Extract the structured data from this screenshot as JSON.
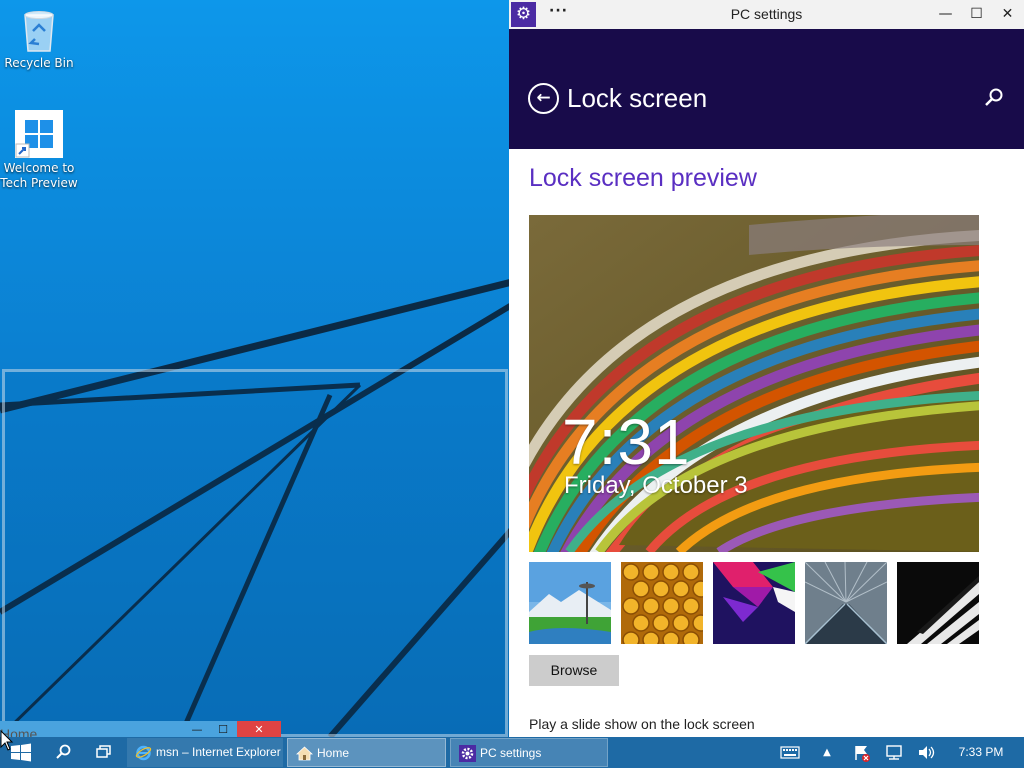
{
  "desktop": {
    "icons": [
      {
        "label": "Recycle Bin"
      },
      {
        "label_line1": "Welcome to",
        "label_line2": "Tech Preview"
      }
    ],
    "home_window_fragment": {
      "title": "Home",
      "minimize": "—",
      "maximize": "☐",
      "close": "✕"
    }
  },
  "settings_window": {
    "title": "PC settings",
    "menu_dots": "···",
    "minimize_glyph": "—",
    "maximize_glyph": "☐",
    "close_glyph": "✕",
    "header": {
      "page_title": "Lock screen",
      "back_glyph": "←"
    },
    "section_title": "Lock screen preview",
    "preview": {
      "time": "7:31",
      "date": "Friday, October 3"
    },
    "thumbnails": [
      "space-needle",
      "honeycomb",
      "abstract-shapes",
      "train-tunnel",
      "piano-keys"
    ],
    "browse_label": "Browse",
    "slideshow_label": "Play a slide show on the lock screen",
    "colors": {
      "header_bg": "#180b4a",
      "accent": "#5a2fc2",
      "app_icon_bg": "#4b2ba3"
    }
  },
  "taskbar": {
    "tasks": [
      {
        "label": "msn – Internet Explorer",
        "icon": "internet-explorer-icon"
      },
      {
        "label": "Home",
        "icon": "home-icon"
      },
      {
        "label": "PC settings",
        "icon": "gear-icon"
      }
    ],
    "tray": {
      "clock": "7:33 PM"
    },
    "colors": {
      "bg": "#1e6aa5"
    }
  }
}
